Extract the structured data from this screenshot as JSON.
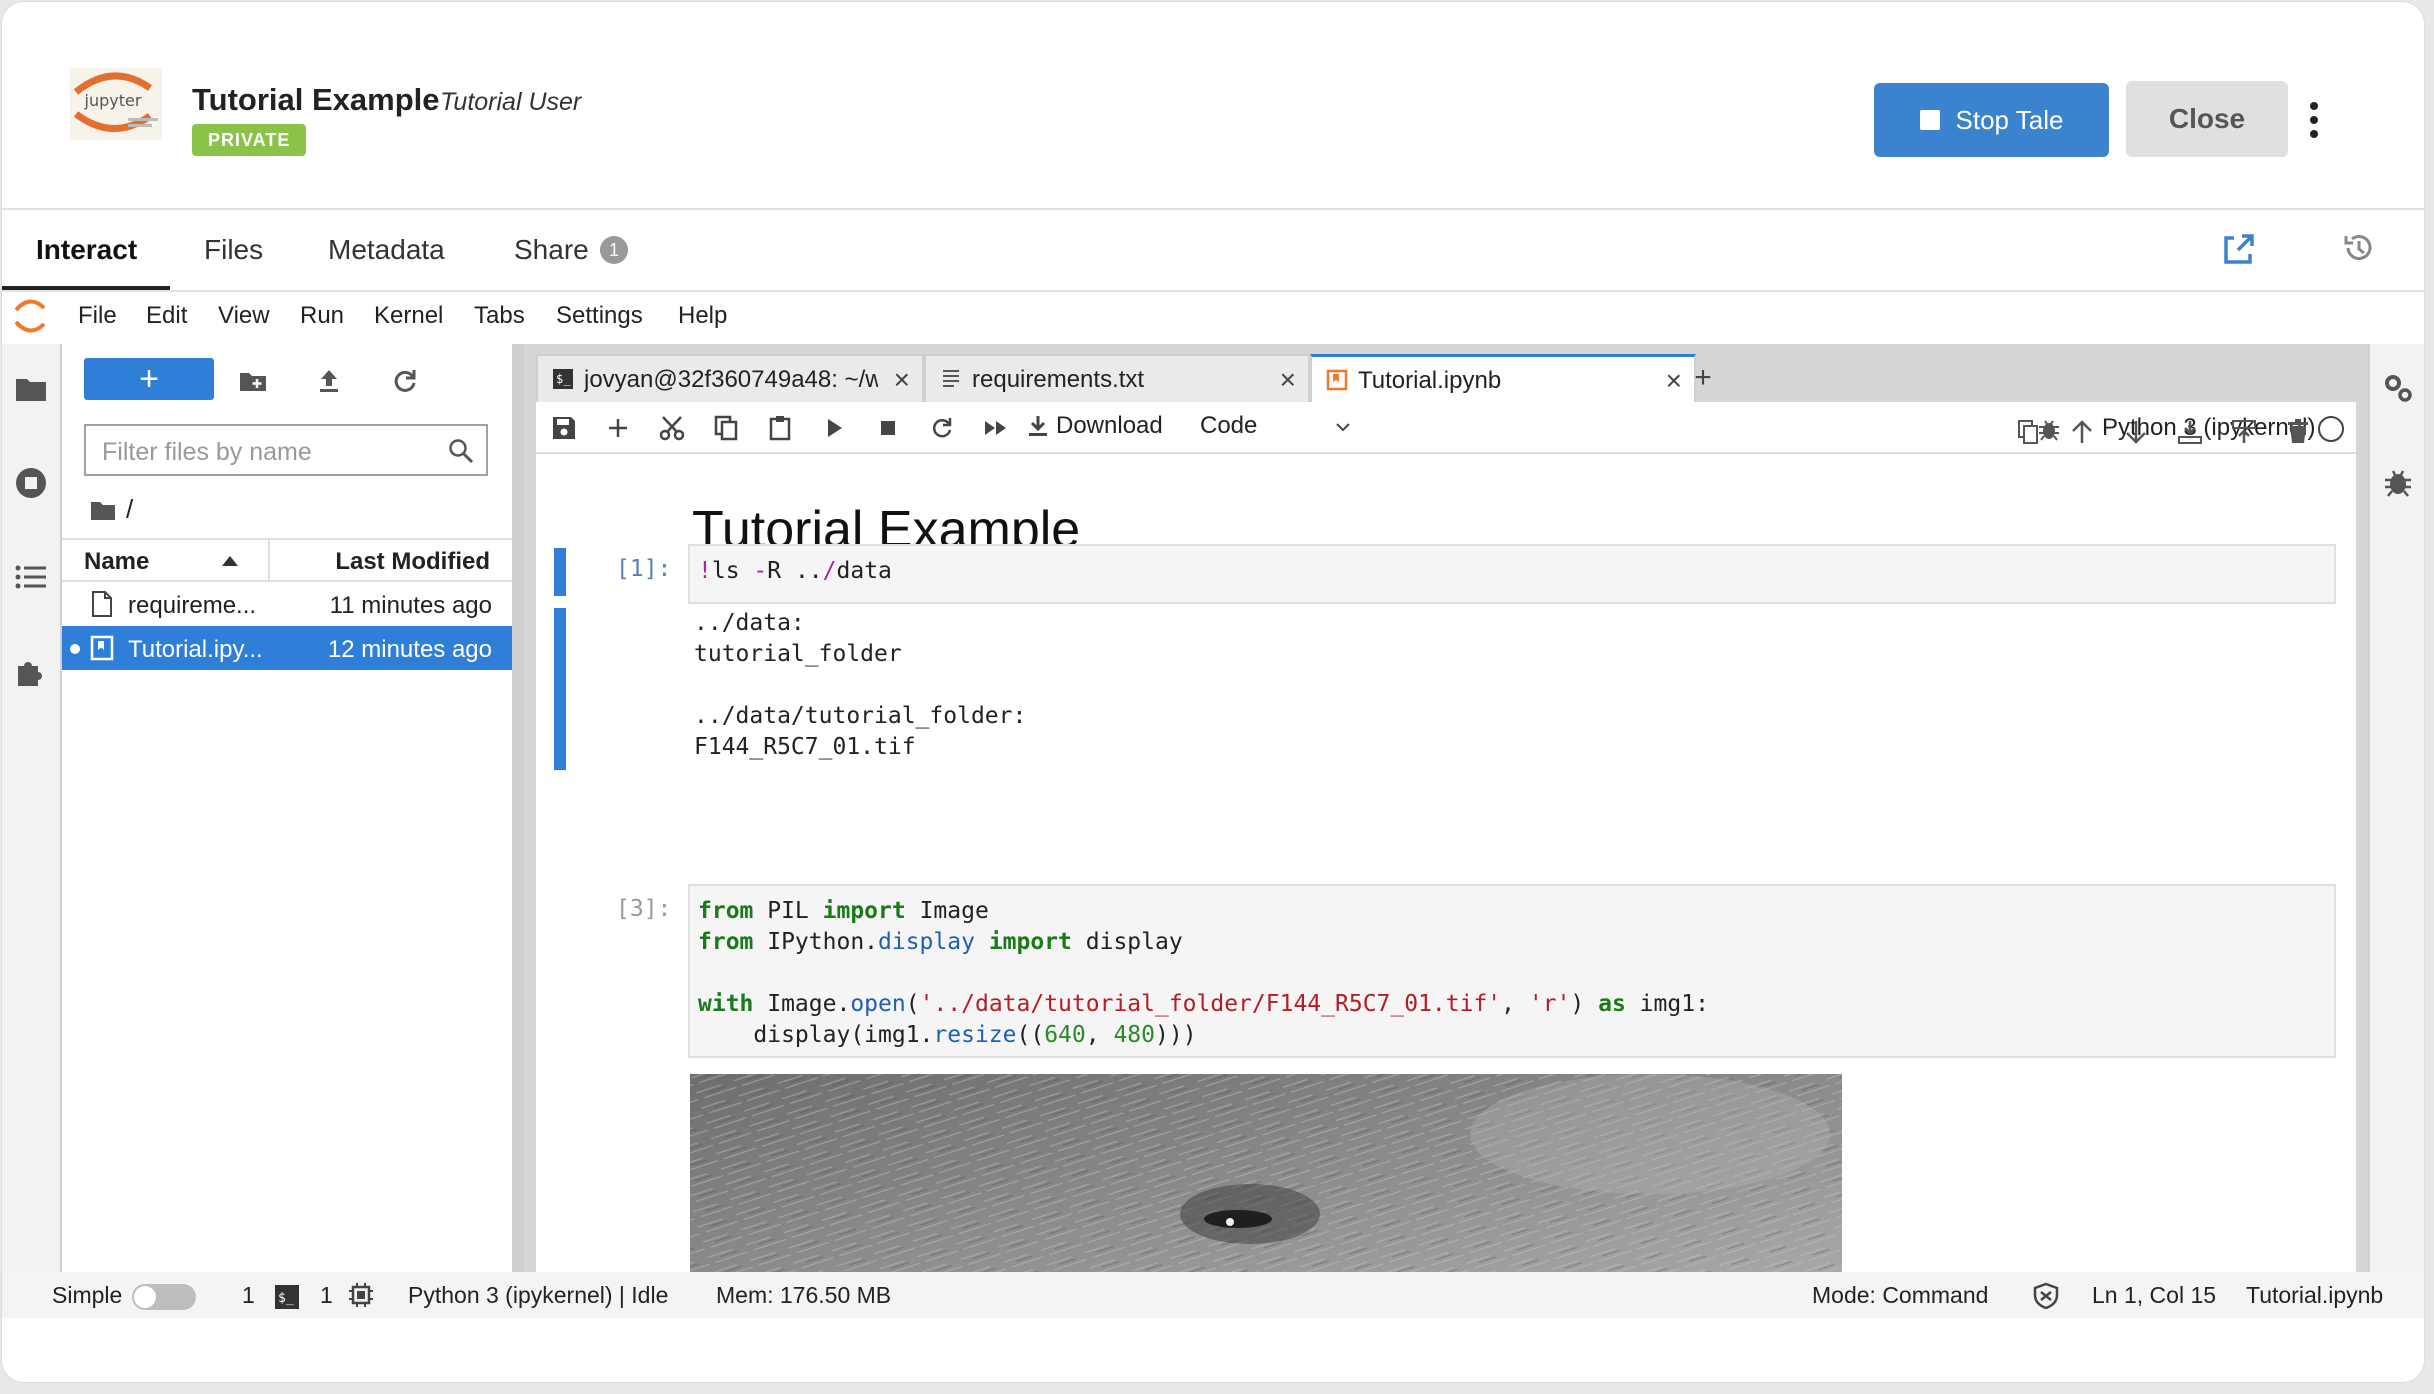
{
  "header": {
    "title": "Tutorial Example",
    "author": "Tutorial User",
    "badge": "PRIVATE",
    "stop_label": "Stop Tale",
    "close_label": "Close"
  },
  "tabs": [
    {
      "label": "Interact",
      "active": true
    },
    {
      "label": "Files"
    },
    {
      "label": "Metadata"
    },
    {
      "label": "Share",
      "count": "1"
    }
  ],
  "menu": [
    "File",
    "Edit",
    "View",
    "Run",
    "Kernel",
    "Tabs",
    "Settings",
    "Help"
  ],
  "filebrowser": {
    "new_label": "+",
    "filter_placeholder": "Filter files by name",
    "breadcrumb": "/",
    "col_name": "Name",
    "col_modified": "Last Modified",
    "files": [
      {
        "name": "requireme...",
        "modified": "11 minutes ago",
        "selected": false
      },
      {
        "name": "Tutorial.ipy...",
        "modified": "12 minutes ago",
        "selected": true
      }
    ]
  },
  "doc_tabs": [
    {
      "label": "jovyan@32f360749a48: ~/w",
      "icon": "terminal-icon"
    },
    {
      "label": "requirements.txt",
      "icon": "text-file-icon"
    },
    {
      "label": "Tutorial.ipynb",
      "icon": "notebook-icon",
      "active": true
    }
  ],
  "notebook_toolbar": {
    "download_label": "Download",
    "cell_type": "Code",
    "kernel": "Python 3 (ipykernel)"
  },
  "notebook": {
    "heading": "Tutorial Example",
    "cell1": {
      "prompt": "[1]:",
      "output": "../data:\ntutorial_folder\n\n../data/tutorial_folder:\nF144_R5C7_01.tif"
    },
    "cell2": {
      "prompt": "[3]:"
    }
  },
  "status": {
    "mode_label": "Simple",
    "terminals": "1",
    "kernels": "1",
    "kernel_status": "Python 3 (ipykernel) | Idle",
    "memory": "Mem: 176.50 MB",
    "mode": "Mode: Command",
    "position": "Ln 1, Col 15",
    "file": "Tutorial.ipynb"
  }
}
